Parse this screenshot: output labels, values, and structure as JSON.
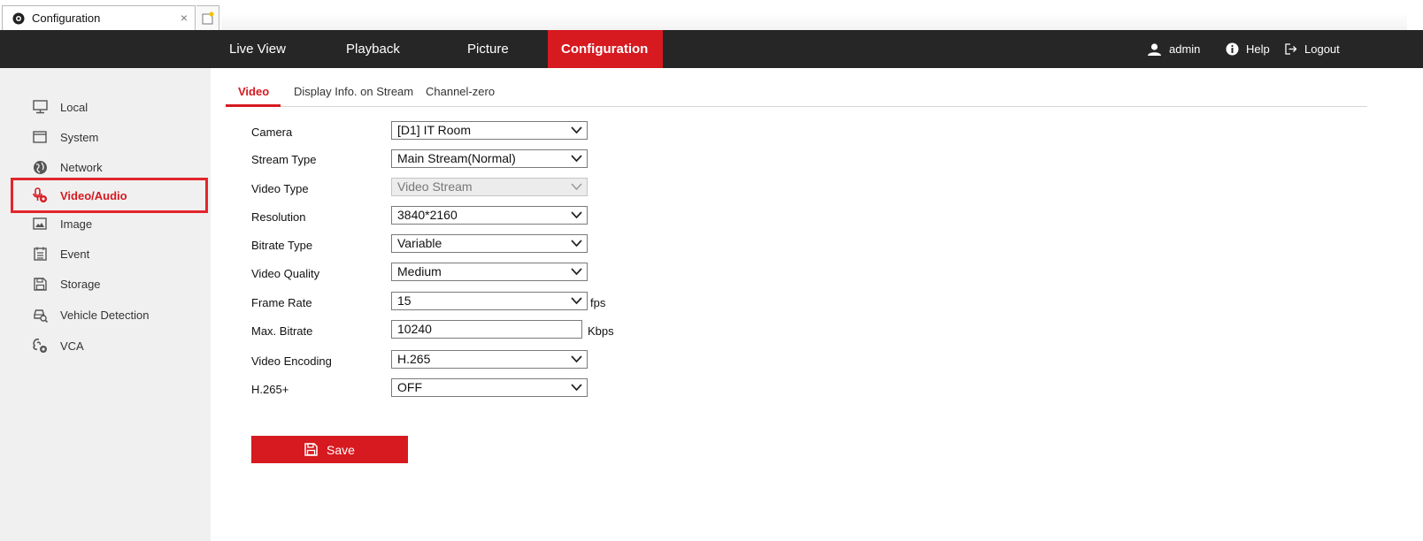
{
  "browser": {
    "tab_title": "Configuration",
    "close_glyph": "×"
  },
  "topnav": {
    "items": [
      "Live View",
      "Playback",
      "Picture",
      "Configuration"
    ],
    "active": "Configuration",
    "user": "admin",
    "help": "Help",
    "logout": "Logout"
  },
  "sidebar": {
    "items": [
      {
        "label": "Local",
        "icon": "monitor-icon"
      },
      {
        "label": "System",
        "icon": "window-icon"
      },
      {
        "label": "Network",
        "icon": "globe-icon"
      },
      {
        "label": "Video/Audio",
        "icon": "mic-camera-icon"
      },
      {
        "label": "Image",
        "icon": "image-icon"
      },
      {
        "label": "Event",
        "icon": "calendar-icon"
      },
      {
        "label": "Storage",
        "icon": "floppy-icon"
      },
      {
        "label": "Vehicle Detection",
        "icon": "car-search-icon"
      },
      {
        "label": "VCA",
        "icon": "vca-icon"
      }
    ],
    "active": "Video/Audio"
  },
  "subtabs": {
    "items": [
      "Video",
      "Display Info. on Stream",
      "Channel-zero"
    ],
    "active": "Video"
  },
  "form": {
    "camera": {
      "label": "Camera",
      "value": "[D1] IT Room"
    },
    "stream_type": {
      "label": "Stream Type",
      "value": "Main Stream(Normal)"
    },
    "video_type": {
      "label": "Video Type",
      "value": "Video Stream",
      "disabled": true
    },
    "resolution": {
      "label": "Resolution",
      "value": "3840*2160"
    },
    "bitrate_type": {
      "label": "Bitrate Type",
      "value": "Variable"
    },
    "video_quality": {
      "label": "Video Quality",
      "value": "Medium"
    },
    "frame_rate": {
      "label": "Frame Rate",
      "value": "15",
      "unit": "fps"
    },
    "max_bitrate": {
      "label": "Max. Bitrate",
      "value": "10240",
      "unit": "Kbps"
    },
    "video_encoding": {
      "label": "Video Encoding",
      "value": "H.265"
    },
    "h265plus": {
      "label": "H.265+",
      "value": "OFF"
    }
  },
  "save_label": "Save",
  "colors": {
    "accent": "#d71920",
    "navbar": "#262626",
    "sidebar": "#f0f0f0"
  }
}
